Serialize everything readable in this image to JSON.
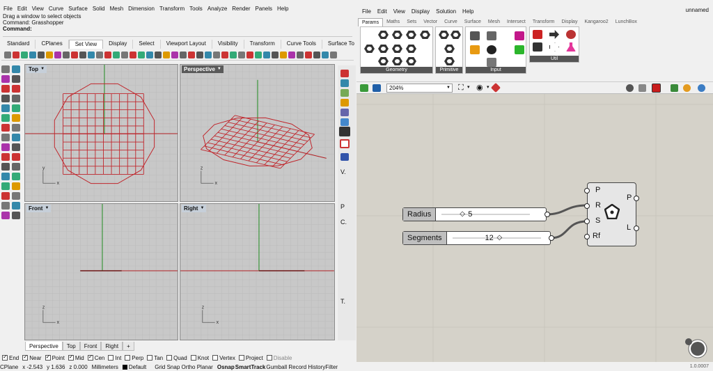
{
  "rhino": {
    "menu": [
      "File",
      "Edit",
      "View",
      "Curve",
      "Surface",
      "Solid",
      "Mesh",
      "Dimension",
      "Transform",
      "Tools",
      "Analyze",
      "Render",
      "Panels",
      "Help"
    ],
    "command_history": [
      "Drag a window to select objects",
      "Command: Grasshopper"
    ],
    "command_prompt": "Command:",
    "toolbar_tabs": [
      "Standard",
      "CPlanes",
      "Set View",
      "Display",
      "Select",
      "Viewport Layout",
      "Visibility",
      "Transform",
      "Curve Tools",
      "Surface To"
    ],
    "selected_toolbar_tab": "Set View",
    "viewports": {
      "top": "Top",
      "perspective": "Perspective",
      "front": "Front",
      "right": "Right",
      "axis_x": "x",
      "axis_y": "y",
      "axis_z": "z"
    },
    "viewport_tabs": [
      "Perspective",
      "Top",
      "Front",
      "Right",
      "+"
    ],
    "right_panel_letters": [
      "V.",
      "P",
      "C.",
      "T."
    ],
    "osnaps": [
      {
        "label": "End",
        "checked": true,
        "disabled": false
      },
      {
        "label": "Near",
        "checked": true,
        "disabled": false
      },
      {
        "label": "Point",
        "checked": true,
        "disabled": false
      },
      {
        "label": "Mid",
        "checked": true,
        "disabled": false
      },
      {
        "label": "Cen",
        "checked": true,
        "disabled": false
      },
      {
        "label": "Int",
        "checked": false,
        "disabled": false
      },
      {
        "label": "Perp",
        "checked": false,
        "disabled": false
      },
      {
        "label": "Tan",
        "checked": false,
        "disabled": false
      },
      {
        "label": "Quad",
        "checked": false,
        "disabled": false
      },
      {
        "label": "Knot",
        "checked": false,
        "disabled": false
      },
      {
        "label": "Vertex",
        "checked": false,
        "disabled": false
      },
      {
        "label": "Project",
        "checked": false,
        "disabled": false
      },
      {
        "label": "Disable",
        "checked": false,
        "disabled": true
      }
    ],
    "status": {
      "cplane": "CPlane",
      "x": "x -2.543",
      "y": "y 1.636",
      "z": "z 0.000",
      "units": "Millimeters",
      "layer": "Default",
      "toggles": "Grid Snap Ortho Planar",
      "osnap": "Osnap",
      "smarttrack": "SmartTrack",
      "gumball": "Gumball Record HistoryFilter"
    },
    "colors": {
      "curve": "#c0262c",
      "x_axis": "#b01e22",
      "y_axis": "#1c8a1c",
      "viewport_bg": "#c8c8c8"
    }
  },
  "grasshopper": {
    "menu": [
      "File",
      "Edit",
      "View",
      "Display",
      "Solution",
      "Help"
    ],
    "document_name": "unnamed",
    "tabs": [
      "Params",
      "Maths",
      "Sets",
      "Vector",
      "Curve",
      "Surface",
      "Mesh",
      "Intersect",
      "Transform",
      "Display",
      "Kangaroo2",
      "LunchBox"
    ],
    "selected_tab": "Params",
    "groups": [
      "Geometry",
      "Primitive",
      "Input",
      "Util"
    ],
    "zoom": "204%",
    "sliders": [
      {
        "name": "Radius",
        "value": "5"
      },
      {
        "name": "Segments",
        "value": "12"
      }
    ],
    "component": {
      "inputs": [
        "P",
        "R",
        "S",
        "Rf"
      ],
      "outputs": [
        "P",
        "L"
      ]
    },
    "version": "1.0.0007"
  }
}
